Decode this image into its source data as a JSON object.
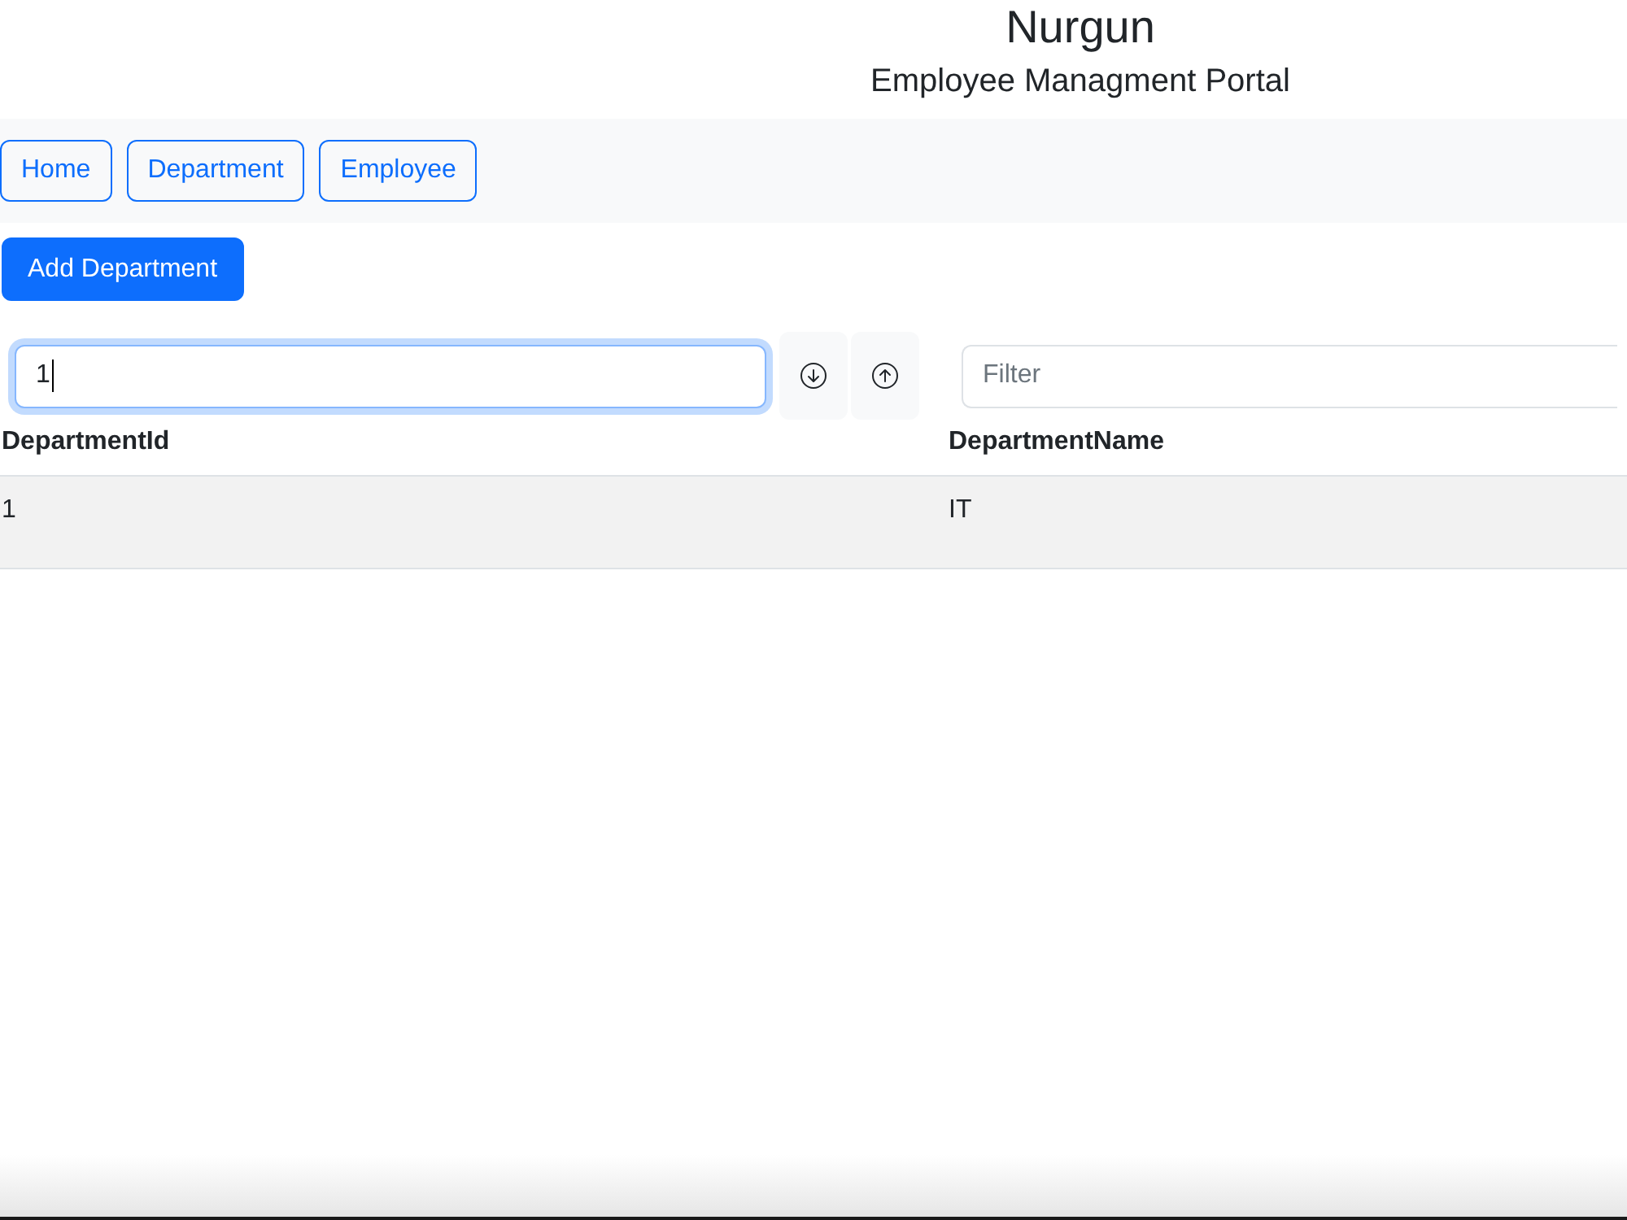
{
  "header": {
    "title": "Nurgun",
    "subtitle": "Employee Managment Portal"
  },
  "nav": {
    "buttons": [
      {
        "label": "Home"
      },
      {
        "label": "Department"
      },
      {
        "label": "Employee"
      }
    ]
  },
  "toolbar": {
    "add_button": {
      "label": "Add Department"
    }
  },
  "table": {
    "columns": [
      {
        "label": "DepartmentId",
        "sortable": true,
        "field": {
          "value": "1",
          "focused": true
        }
      },
      {
        "label": "DepartmentName",
        "field": {
          "placeholder": "Filter",
          "focused": false
        }
      }
    ],
    "rows": [
      {
        "cells": [
          "1",
          "IT"
        ]
      }
    ]
  }
}
